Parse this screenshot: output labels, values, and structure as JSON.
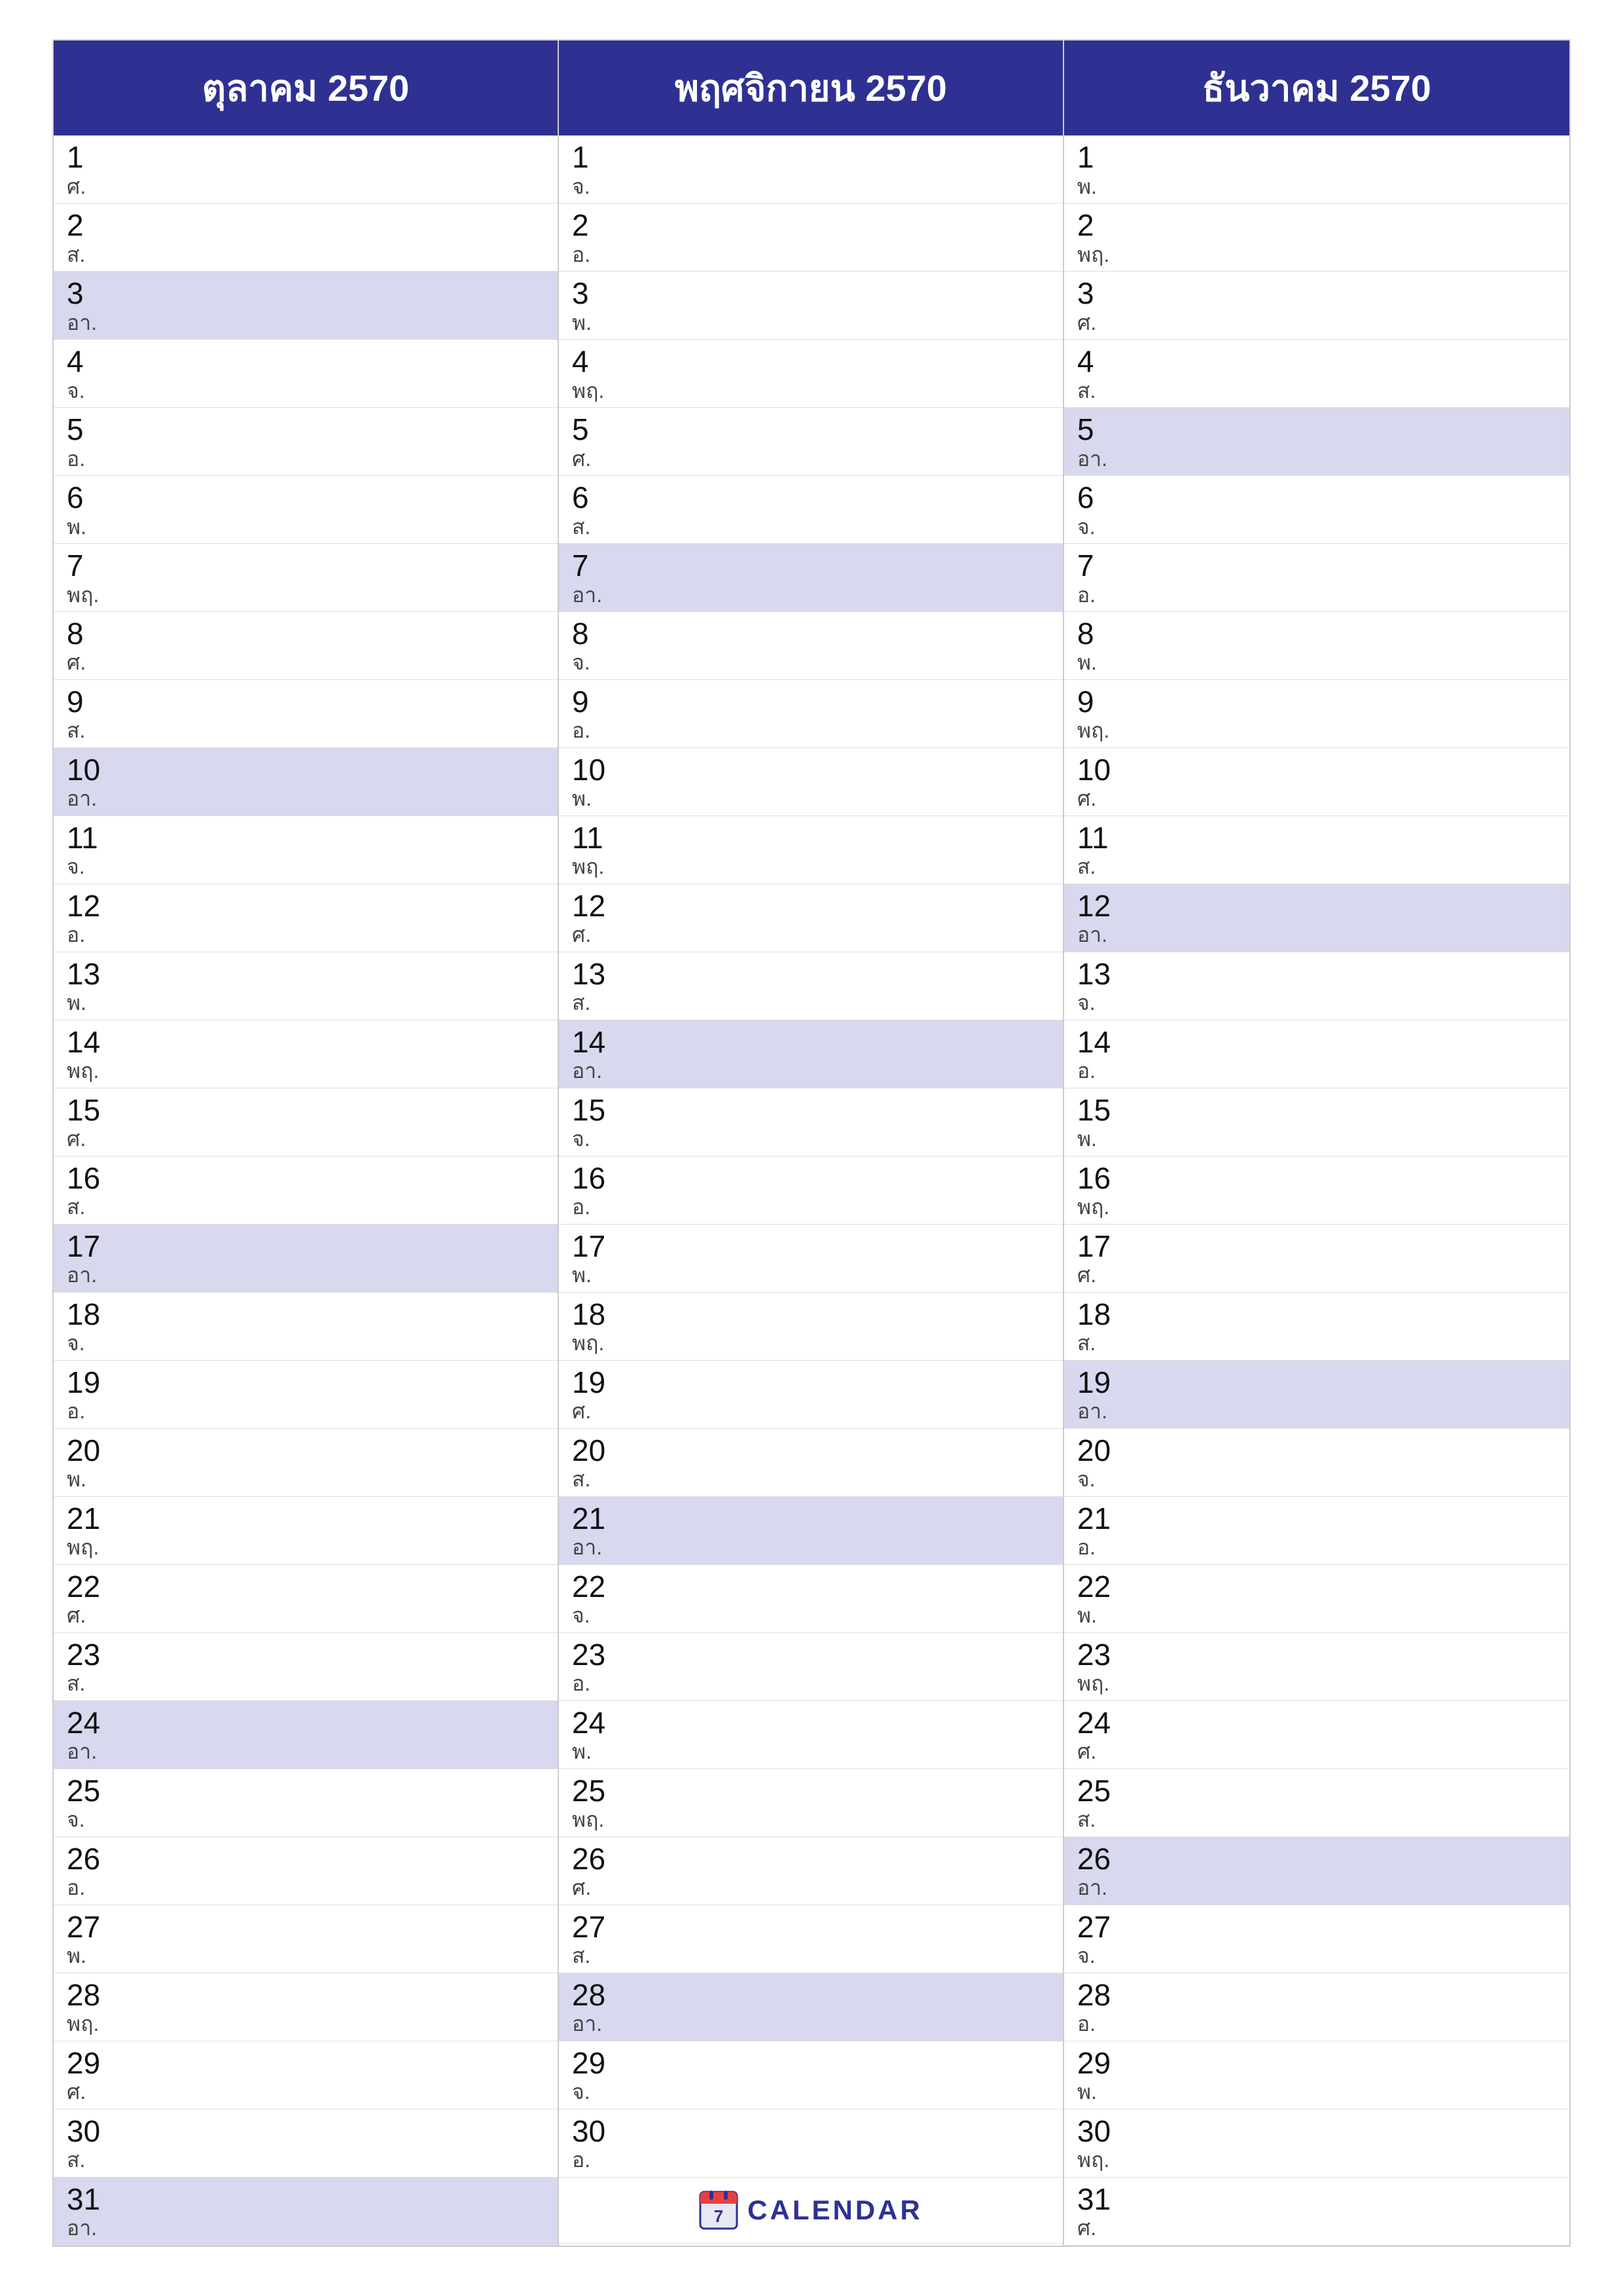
{
  "months": [
    {
      "name": "ตุลาคม 2570",
      "days": [
        {
          "num": "1",
          "day": "ศ.",
          "highlight": false
        },
        {
          "num": "2",
          "day": "ส.",
          "highlight": false
        },
        {
          "num": "3",
          "day": "อา.",
          "highlight": true
        },
        {
          "num": "4",
          "day": "จ.",
          "highlight": false
        },
        {
          "num": "5",
          "day": "อ.",
          "highlight": false
        },
        {
          "num": "6",
          "day": "พ.",
          "highlight": false
        },
        {
          "num": "7",
          "day": "พฤ.",
          "highlight": false
        },
        {
          "num": "8",
          "day": "ศ.",
          "highlight": false
        },
        {
          "num": "9",
          "day": "ส.",
          "highlight": false
        },
        {
          "num": "10",
          "day": "อา.",
          "highlight": true
        },
        {
          "num": "11",
          "day": "จ.",
          "highlight": false
        },
        {
          "num": "12",
          "day": "อ.",
          "highlight": false
        },
        {
          "num": "13",
          "day": "พ.",
          "highlight": false
        },
        {
          "num": "14",
          "day": "พฤ.",
          "highlight": false
        },
        {
          "num": "15",
          "day": "ศ.",
          "highlight": false
        },
        {
          "num": "16",
          "day": "ส.",
          "highlight": false
        },
        {
          "num": "17",
          "day": "อา.",
          "highlight": true
        },
        {
          "num": "18",
          "day": "จ.",
          "highlight": false
        },
        {
          "num": "19",
          "day": "อ.",
          "highlight": false
        },
        {
          "num": "20",
          "day": "พ.",
          "highlight": false
        },
        {
          "num": "21",
          "day": "พฤ.",
          "highlight": false
        },
        {
          "num": "22",
          "day": "ศ.",
          "highlight": false
        },
        {
          "num": "23",
          "day": "ส.",
          "highlight": false
        },
        {
          "num": "24",
          "day": "อา.",
          "highlight": true
        },
        {
          "num": "25",
          "day": "จ.",
          "highlight": false
        },
        {
          "num": "26",
          "day": "อ.",
          "highlight": false
        },
        {
          "num": "27",
          "day": "พ.",
          "highlight": false
        },
        {
          "num": "28",
          "day": "พฤ.",
          "highlight": false
        },
        {
          "num": "29",
          "day": "ศ.",
          "highlight": false
        },
        {
          "num": "30",
          "day": "ส.",
          "highlight": false
        },
        {
          "num": "31",
          "day": "อา.",
          "highlight": true
        }
      ]
    },
    {
      "name": "พฤศจิกายน 2570",
      "days": [
        {
          "num": "1",
          "day": "จ.",
          "highlight": false
        },
        {
          "num": "2",
          "day": "อ.",
          "highlight": false
        },
        {
          "num": "3",
          "day": "พ.",
          "highlight": false
        },
        {
          "num": "4",
          "day": "พฤ.",
          "highlight": false
        },
        {
          "num": "5",
          "day": "ศ.",
          "highlight": false
        },
        {
          "num": "6",
          "day": "ส.",
          "highlight": false
        },
        {
          "num": "7",
          "day": "อา.",
          "highlight": true
        },
        {
          "num": "8",
          "day": "จ.",
          "highlight": false
        },
        {
          "num": "9",
          "day": "อ.",
          "highlight": false
        },
        {
          "num": "10",
          "day": "พ.",
          "highlight": false
        },
        {
          "num": "11",
          "day": "พฤ.",
          "highlight": false
        },
        {
          "num": "12",
          "day": "ศ.",
          "highlight": false
        },
        {
          "num": "13",
          "day": "ส.",
          "highlight": false
        },
        {
          "num": "14",
          "day": "อา.",
          "highlight": true
        },
        {
          "num": "15",
          "day": "จ.",
          "highlight": false
        },
        {
          "num": "16",
          "day": "อ.",
          "highlight": false
        },
        {
          "num": "17",
          "day": "พ.",
          "highlight": false
        },
        {
          "num": "18",
          "day": "พฤ.",
          "highlight": false
        },
        {
          "num": "19",
          "day": "ศ.",
          "highlight": false
        },
        {
          "num": "20",
          "day": "ส.",
          "highlight": false
        },
        {
          "num": "21",
          "day": "อา.",
          "highlight": true
        },
        {
          "num": "22",
          "day": "จ.",
          "highlight": false
        },
        {
          "num": "23",
          "day": "อ.",
          "highlight": false
        },
        {
          "num": "24",
          "day": "พ.",
          "highlight": false
        },
        {
          "num": "25",
          "day": "พฤ.",
          "highlight": false
        },
        {
          "num": "26",
          "day": "ศ.",
          "highlight": false
        },
        {
          "num": "27",
          "day": "ส.",
          "highlight": false
        },
        {
          "num": "28",
          "day": "อา.",
          "highlight": true
        },
        {
          "num": "29",
          "day": "จ.",
          "highlight": false
        },
        {
          "num": "30",
          "day": "อ.",
          "highlight": false
        },
        {
          "num": "",
          "day": "",
          "highlight": false,
          "logo": true
        }
      ]
    },
    {
      "name": "ธันวาคม 2570",
      "days": [
        {
          "num": "1",
          "day": "พ.",
          "highlight": false
        },
        {
          "num": "2",
          "day": "พฤ.",
          "highlight": false
        },
        {
          "num": "3",
          "day": "ศ.",
          "highlight": false
        },
        {
          "num": "4",
          "day": "ส.",
          "highlight": false
        },
        {
          "num": "5",
          "day": "อา.",
          "highlight": true
        },
        {
          "num": "6",
          "day": "จ.",
          "highlight": false
        },
        {
          "num": "7",
          "day": "อ.",
          "highlight": false
        },
        {
          "num": "8",
          "day": "พ.",
          "highlight": false
        },
        {
          "num": "9",
          "day": "พฤ.",
          "highlight": false
        },
        {
          "num": "10",
          "day": "ศ.",
          "highlight": false
        },
        {
          "num": "11",
          "day": "ส.",
          "highlight": false
        },
        {
          "num": "12",
          "day": "อา.",
          "highlight": true
        },
        {
          "num": "13",
          "day": "จ.",
          "highlight": false
        },
        {
          "num": "14",
          "day": "อ.",
          "highlight": false
        },
        {
          "num": "15",
          "day": "พ.",
          "highlight": false
        },
        {
          "num": "16",
          "day": "พฤ.",
          "highlight": false
        },
        {
          "num": "17",
          "day": "ศ.",
          "highlight": false
        },
        {
          "num": "18",
          "day": "ส.",
          "highlight": false
        },
        {
          "num": "19",
          "day": "อา.",
          "highlight": true
        },
        {
          "num": "20",
          "day": "จ.",
          "highlight": false
        },
        {
          "num": "21",
          "day": "อ.",
          "highlight": false
        },
        {
          "num": "22",
          "day": "พ.",
          "highlight": false
        },
        {
          "num": "23",
          "day": "พฤ.",
          "highlight": false
        },
        {
          "num": "24",
          "day": "ศ.",
          "highlight": false
        },
        {
          "num": "25",
          "day": "ส.",
          "highlight": false
        },
        {
          "num": "26",
          "day": "อา.",
          "highlight": true
        },
        {
          "num": "27",
          "day": "จ.",
          "highlight": false
        },
        {
          "num": "28",
          "day": "อ.",
          "highlight": false
        },
        {
          "num": "29",
          "day": "พ.",
          "highlight": false
        },
        {
          "num": "30",
          "day": "พฤ.",
          "highlight": false
        },
        {
          "num": "31",
          "day": "ศ.",
          "highlight": false
        }
      ]
    }
  ],
  "logo": {
    "text": "CALENDAR",
    "icon": "7"
  }
}
